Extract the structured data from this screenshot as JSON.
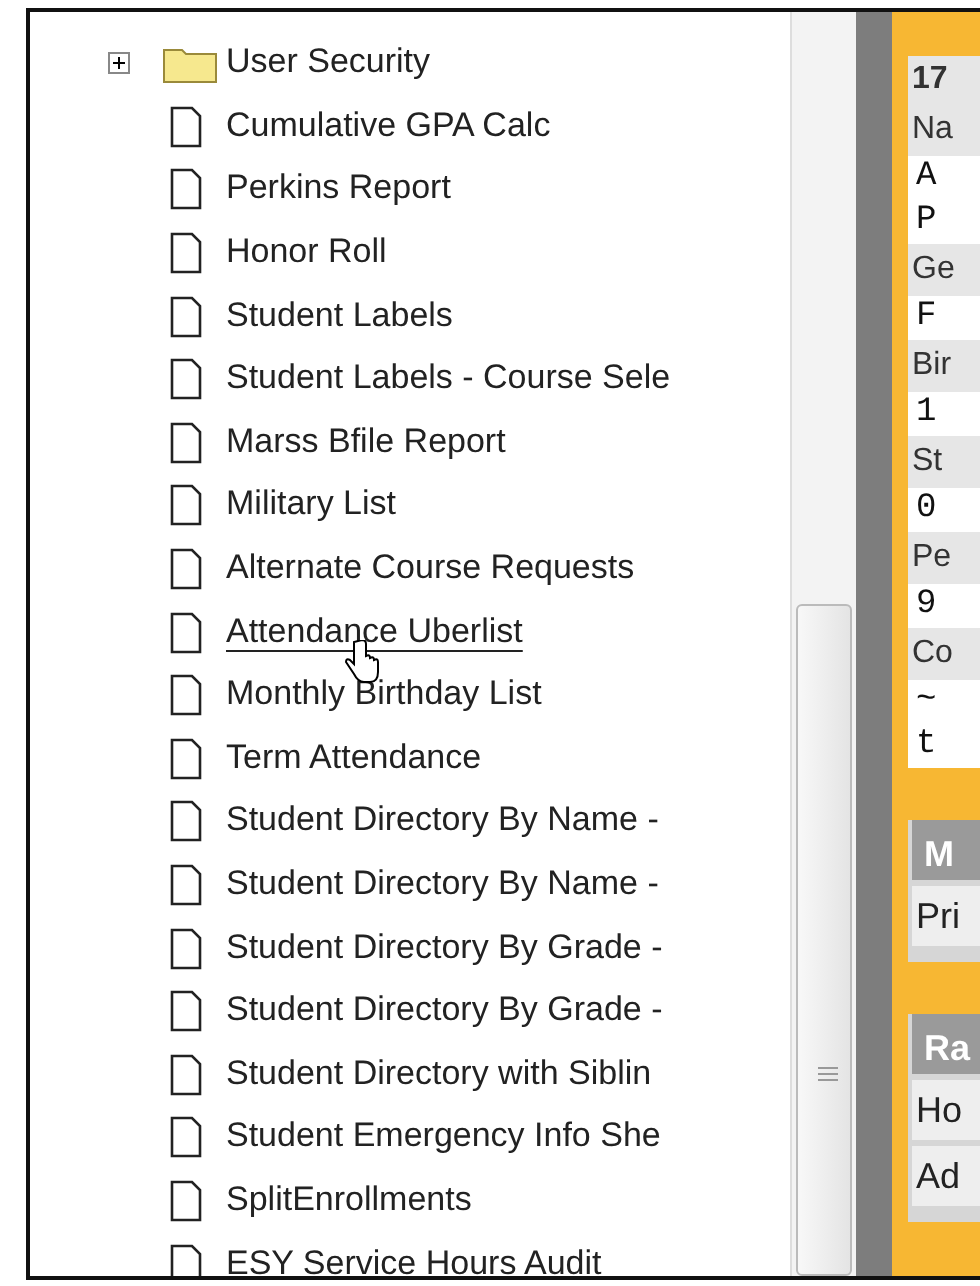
{
  "tree": {
    "items": [
      {
        "kind": "folder",
        "label": "User Security",
        "expanded": false,
        "hovered": false
      },
      {
        "kind": "report",
        "label": "Cumulative GPA Calc",
        "hovered": false
      },
      {
        "kind": "report",
        "label": "Perkins Report",
        "hovered": false
      },
      {
        "kind": "report",
        "label": "Honor Roll",
        "hovered": false
      },
      {
        "kind": "report",
        "label": "Student Labels",
        "hovered": false
      },
      {
        "kind": "report",
        "label": "Student Labels - Course Sele",
        "hovered": false
      },
      {
        "kind": "report",
        "label": "Marss Bfile Report",
        "hovered": false
      },
      {
        "kind": "report",
        "label": "Military List",
        "hovered": false
      },
      {
        "kind": "report",
        "label": "Alternate Course Requests",
        "hovered": false
      },
      {
        "kind": "report",
        "label": "Attendance Uberlist",
        "hovered": true
      },
      {
        "kind": "report",
        "label": "Monthly Birthday List",
        "hovered": false
      },
      {
        "kind": "report",
        "label": "Term Attendance",
        "hovered": false
      },
      {
        "kind": "report",
        "label": "Student Directory By Name -",
        "hovered": false
      },
      {
        "kind": "report",
        "label": "Student Directory By Name -",
        "hovered": false
      },
      {
        "kind": "report",
        "label": "Student Directory By Grade -",
        "hovered": false
      },
      {
        "kind": "report",
        "label": "Student Directory By Grade -",
        "hovered": false
      },
      {
        "kind": "report",
        "label": "Student Directory with Siblin",
        "hovered": false
      },
      {
        "kind": "report",
        "label": "Student Emergency Info She",
        "hovered": false
      },
      {
        "kind": "report",
        "label": "SplitEnrollments",
        "hovered": false
      },
      {
        "kind": "report",
        "label": "ESY Service Hours Audit",
        "hovered": false
      }
    ]
  },
  "detail_panel": {
    "fields": [
      {
        "kind": "bold",
        "text": "17"
      },
      {
        "kind": "label",
        "text": "Na"
      },
      {
        "kind": "value",
        "text": "A"
      },
      {
        "kind": "value",
        "text": "P"
      },
      {
        "kind": "label",
        "text": "Ge"
      },
      {
        "kind": "value",
        "text": "F"
      },
      {
        "kind": "label",
        "text": "Bir"
      },
      {
        "kind": "value",
        "text": "1"
      },
      {
        "kind": "label",
        "text": "St"
      },
      {
        "kind": "value",
        "text": "0"
      },
      {
        "kind": "label",
        "text": "Pe"
      },
      {
        "kind": "value",
        "text": "9"
      },
      {
        "kind": "label",
        "text": "Co"
      },
      {
        "kind": "value",
        "text": "~"
      },
      {
        "kind": "value",
        "text": "t"
      }
    ],
    "sections": [
      {
        "title": "M",
        "rows": [
          "Pri"
        ]
      },
      {
        "title": "Ra",
        "rows": [
          "Ho",
          "Ad"
        ]
      }
    ]
  }
}
